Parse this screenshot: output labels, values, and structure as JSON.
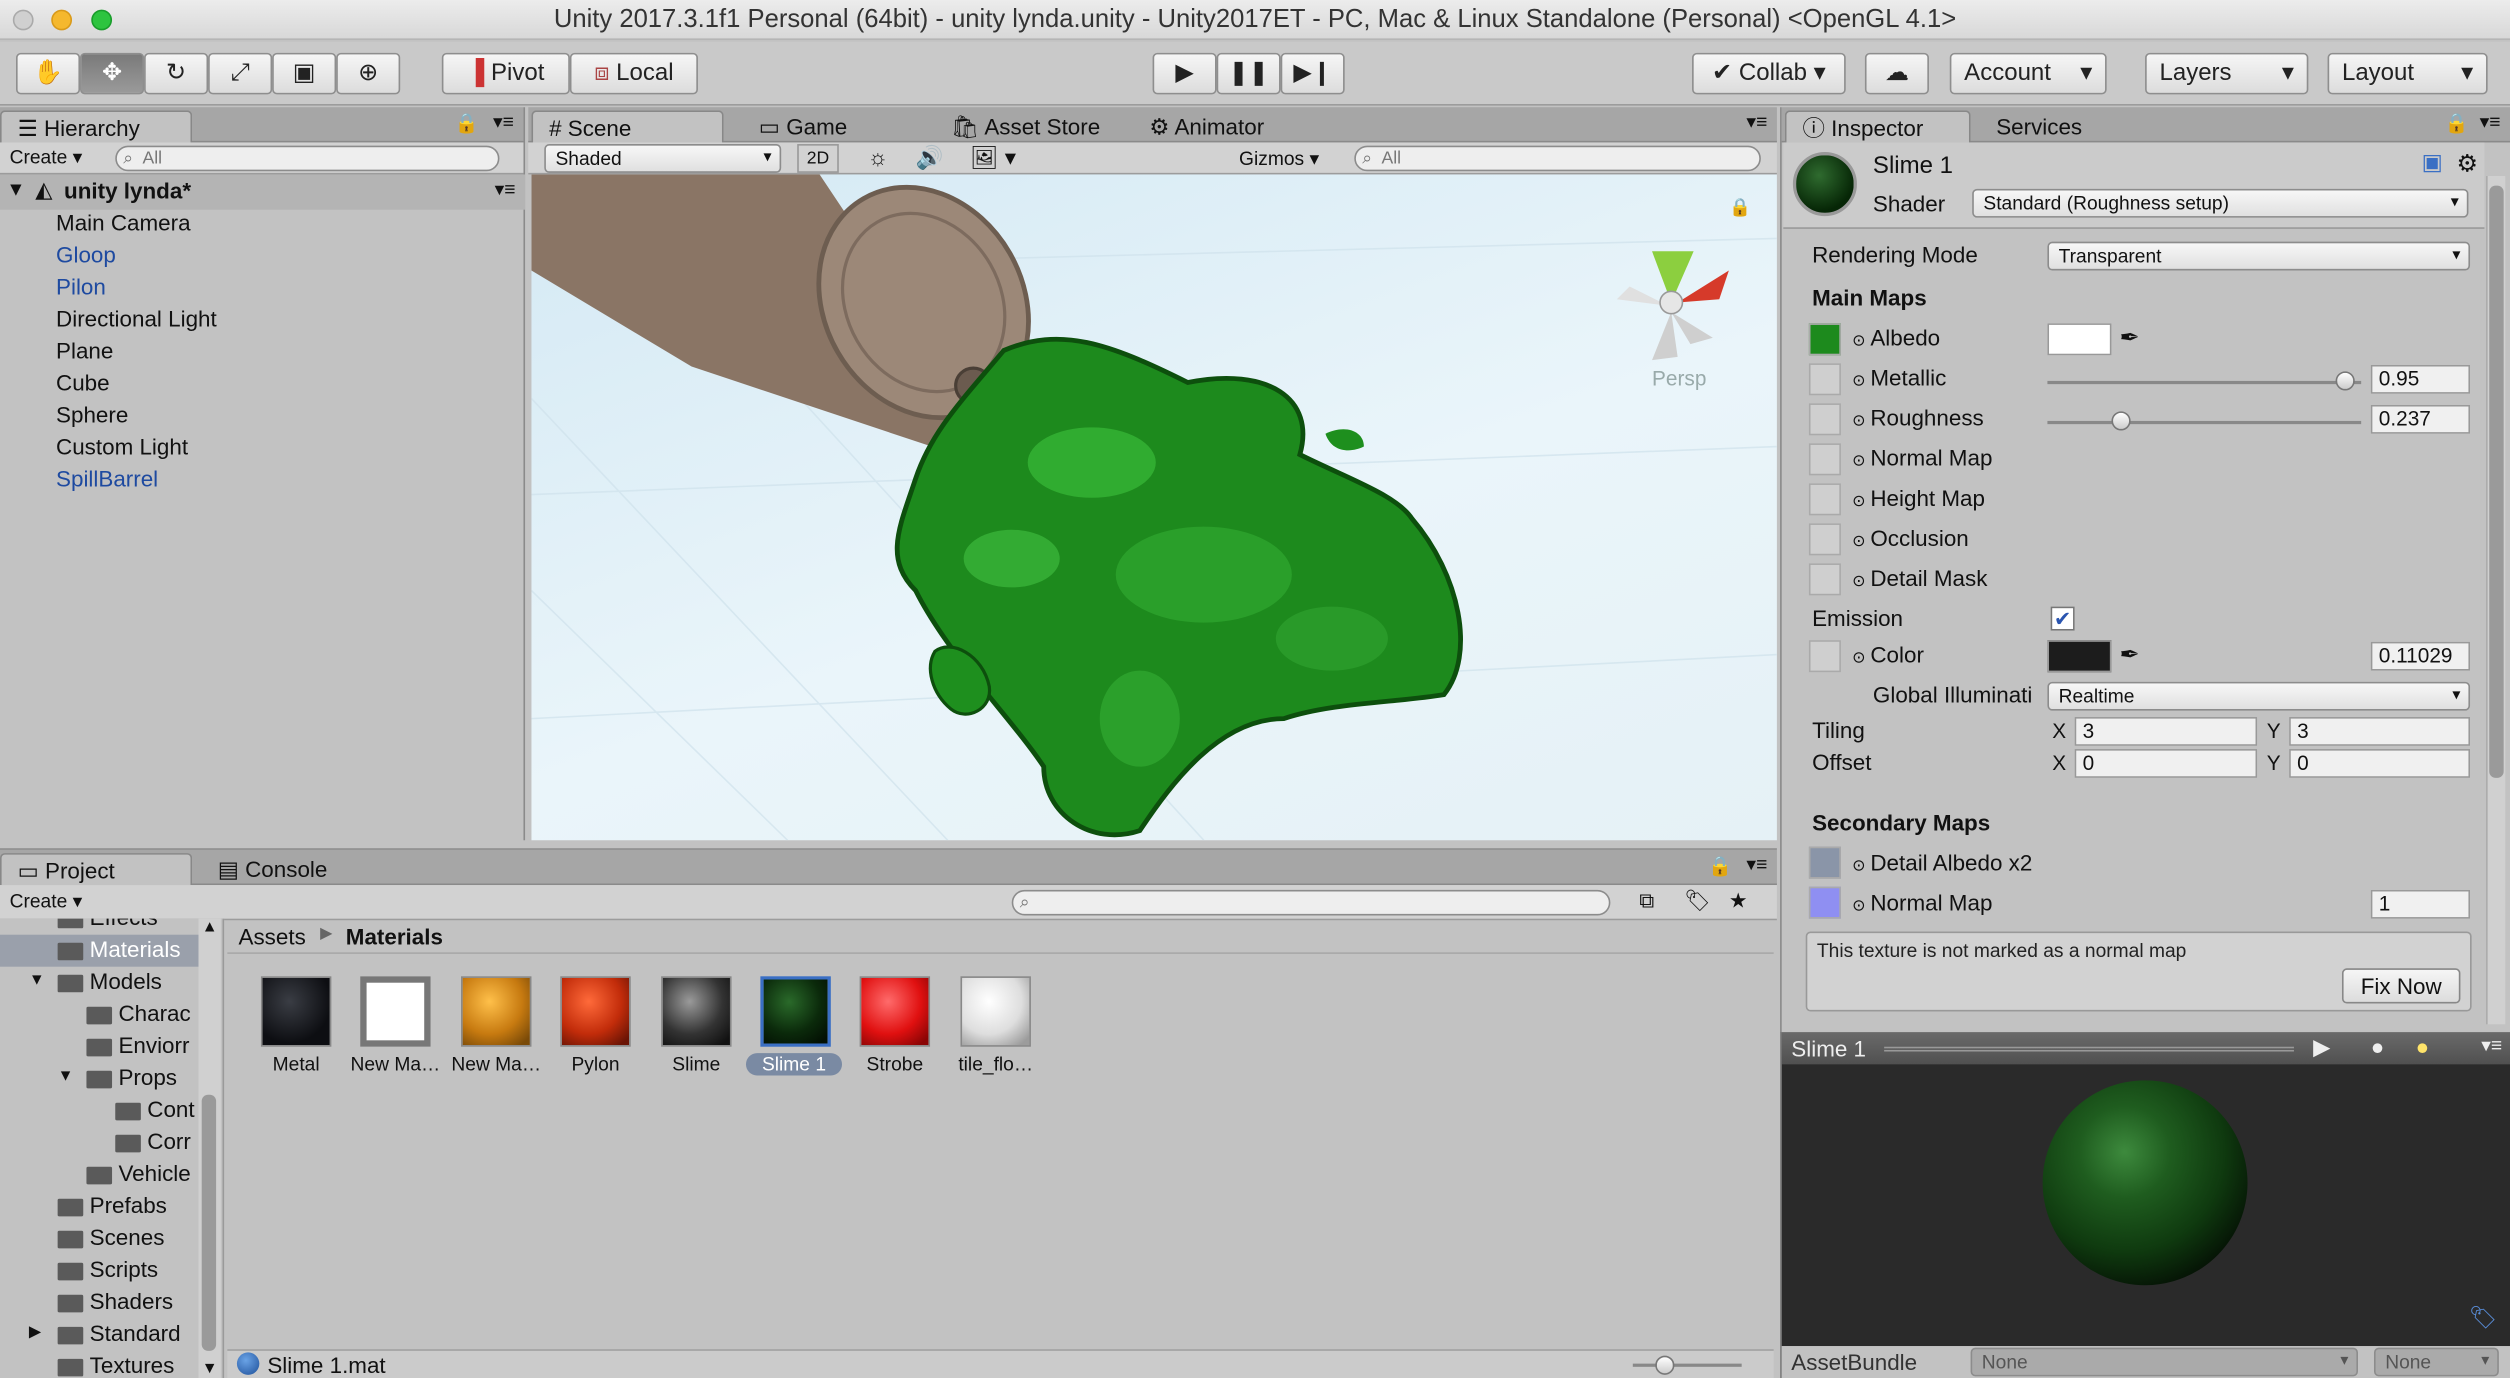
{
  "window": {
    "title": "Unity 2017.3.1f1 Personal (64bit) - unity lynda.unity - Unity2017ET - PC, Mac & Linux Standalone (Personal) <OpenGL 4.1>"
  },
  "toolbar": {
    "pivot": "Pivot",
    "local": "Local",
    "collab": "Collab",
    "account": "Account",
    "layers": "Layers",
    "layout": "Layout",
    "tools": [
      "hand-icon",
      "move-icon",
      "rotate-icon",
      "scale-icon",
      "rect-icon",
      "transform-icon"
    ]
  },
  "hierarchy": {
    "tab": "Hierarchy",
    "create": "Create",
    "search_placeholder": "All",
    "scene": "unity lynda*",
    "items": [
      {
        "label": "Main Camera",
        "prefab": false
      },
      {
        "label": "Gloop",
        "prefab": true
      },
      {
        "label": "Pilon",
        "prefab": true
      },
      {
        "label": "Directional Light",
        "prefab": false
      },
      {
        "label": "Plane",
        "prefab": false
      },
      {
        "label": "Cube",
        "prefab": false
      },
      {
        "label": "Sphere",
        "prefab": false
      },
      {
        "label": "Custom Light",
        "prefab": false
      },
      {
        "label": "SpillBarrel",
        "prefab": true
      }
    ]
  },
  "scene_view": {
    "tabs": [
      "Scene",
      "Game",
      "Asset Store",
      "Animator"
    ],
    "shading": "Shaded",
    "mode_2d": "2D",
    "gizmos": "Gizmos",
    "search_placeholder": "All",
    "persp": "Persp"
  },
  "inspector": {
    "tabs": [
      "Inspector",
      "Services"
    ],
    "material_name": "Slime 1",
    "shader_label": "Shader",
    "shader": "Standard (Roughness setup)",
    "rendering_mode_label": "Rendering Mode",
    "rendering_mode": "Transparent",
    "main_maps": "Main Maps",
    "albedo": "Albedo",
    "metallic": "Metallic",
    "metallic_value": "0.95",
    "roughness": "Roughness",
    "roughness_value": "0.237",
    "normal_map": "Normal Map",
    "height_map": "Height Map",
    "occlusion": "Occlusion",
    "detail_mask": "Detail Mask",
    "emission": "Emission",
    "color": "Color",
    "color_value": "0.11029",
    "gi_label": "Global Illuminati",
    "gi_value": "Realtime",
    "tiling": "Tiling",
    "offset": "Offset",
    "x": "X",
    "y": "Y",
    "tiling_x": "3",
    "tiling_y": "3",
    "offset_x": "0",
    "offset_y": "0",
    "secondary_maps": "Secondary Maps",
    "detail_albedo": "Detail Albedo x2",
    "normal_map2": "Normal Map",
    "normal_scale": "1",
    "warning": "This texture is not marked as a normal map",
    "fix_now": "Fix Now",
    "metallic_fraction": 0.95,
    "roughness_fraction": 0.237,
    "emission_enabled": true
  },
  "preview": {
    "title": "Slime 1",
    "asset_bundle": "AssetBundle",
    "bundle_value": "None",
    "variant_value": "None"
  },
  "project": {
    "tabs": [
      "Project",
      "Console"
    ],
    "create": "Create",
    "breadcrumb": [
      "Assets",
      "Materials"
    ],
    "tree": [
      "Effects",
      "Materials",
      "Models",
      "Charac",
      "Enviorr",
      "Props",
      "Cont",
      "Corr",
      "Vehicle",
      "Prefabs",
      "Scenes",
      "Scripts",
      "Shaders",
      "Standard",
      "Textures"
    ],
    "assets": [
      "Metal",
      "New Ma…",
      "New Ma…",
      "Pylon",
      "Slime",
      "Slime 1",
      "Strobe",
      "tile_flo…"
    ],
    "selected_file": "Slime 1.mat"
  },
  "colors": {
    "accent": "#3a6fc4",
    "slime": "#1e8a1e",
    "prefab": "#1e4aa0"
  }
}
